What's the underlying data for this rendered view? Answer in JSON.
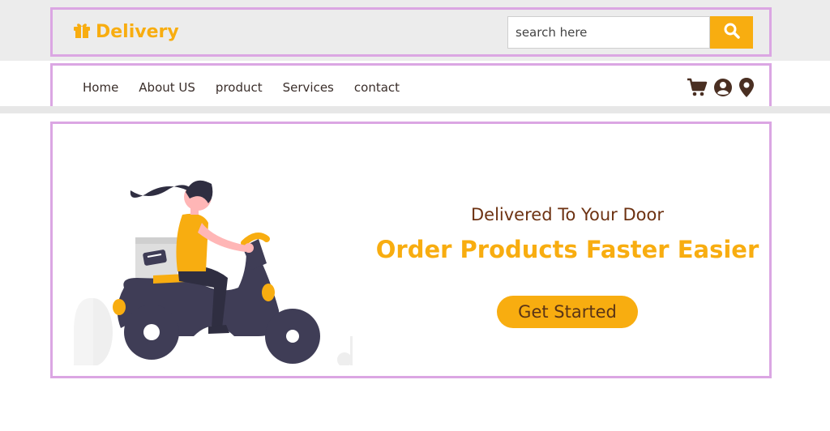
{
  "header": {
    "logo_text": "Delivery",
    "search_placeholder": "search here"
  },
  "nav": {
    "links": [
      "Home",
      "About US",
      "product",
      "Services",
      "contact"
    ]
  },
  "hero": {
    "subtitle": "Delivered To Your Door",
    "title": "Order Products Faster Easier",
    "cta_label": "Get Started"
  },
  "icons": [
    "gift-icon",
    "search-icon",
    "cart-icon",
    "user-icon",
    "location-icon"
  ],
  "colors": {
    "accent": "#f8ad10",
    "header_bg": "#ececec",
    "outline": "#dba6e3",
    "brown_text": "#6d3212",
    "icon_dark": "#4a2f22"
  }
}
